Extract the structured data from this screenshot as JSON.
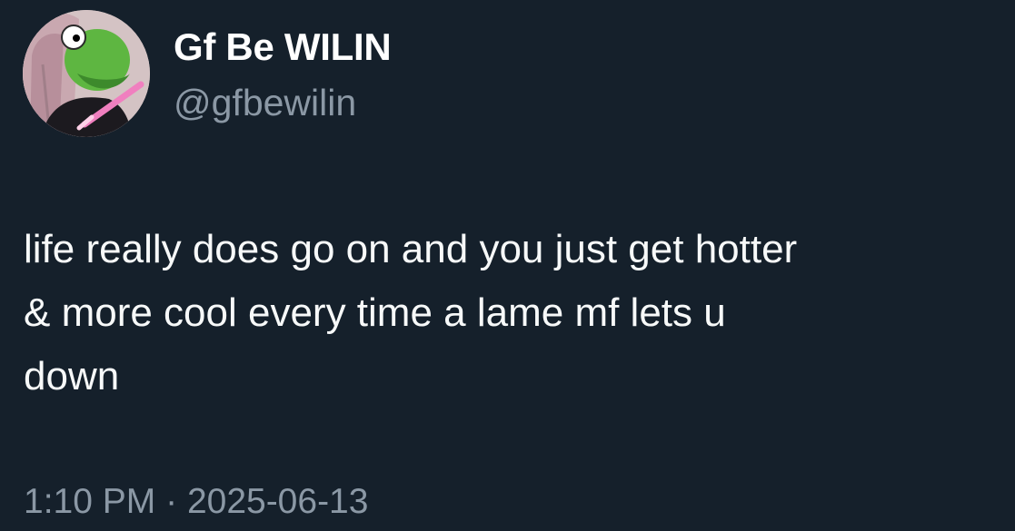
{
  "author": {
    "display_name": "Gf Be WILIN",
    "handle": "@gfbewilin",
    "avatar_icon": "kermit-avatar-icon"
  },
  "tweet": {
    "text": "life really does go on and you just get hotter\n& more cool every time a lame mf lets u\ndown",
    "time": "1:10 PM",
    "separator": "·",
    "date": "2025-06-13"
  },
  "colors": {
    "background": "#15202b",
    "text": "#f7f9f9",
    "secondary_text": "#8b98a5"
  }
}
